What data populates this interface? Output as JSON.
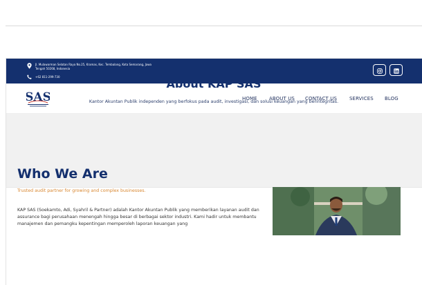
{
  "topbar": {
    "address": "Jl. Mulawarman Selatan Raya No.25, Kramas, Kec. Tembalang, Kota Semarang, Jawa Tengah 50268, Indonesia",
    "phone": "+62 811-299-730",
    "background": "#14306e"
  },
  "nav": {
    "items": [
      {
        "label": "HOME"
      },
      {
        "label": "ABOUT US"
      },
      {
        "label": "CONTACT US"
      },
      {
        "label": "SERVICES"
      },
      {
        "label": "BLOG"
      }
    ]
  },
  "logo": {
    "text": "SAS"
  },
  "hero": {
    "title": "About KAP SAS",
    "subtitle": "Kantor Akuntan Publik independen yang berfokus pada audit, investigasi, dan solusi keuangan yang berintegritas."
  },
  "who": {
    "title": "Who We Are",
    "tagline": "Trusted audit partner for growing and complex businesses.",
    "body": "KAP SAS (Soekamto, Adi, Syahril & Partner) adalah Kantor Akuntan Publik yang memberikan layanan audit dan assurance bagi perusahaan menengah hingga besar di berbagai sektor industri. Kami hadir untuk membantu manajemen dan pemangku kepentingan memperoleh laporan keuangan yang"
  },
  "colors": {
    "primary": "#14306e",
    "accent": "#d8862f",
    "hero_bg": "#f1f1f1"
  },
  "icons": {
    "address": "location-pin-icon",
    "phone": "phone-icon",
    "instagram": "instagram-icon",
    "linkedin": "linkedin-icon"
  }
}
